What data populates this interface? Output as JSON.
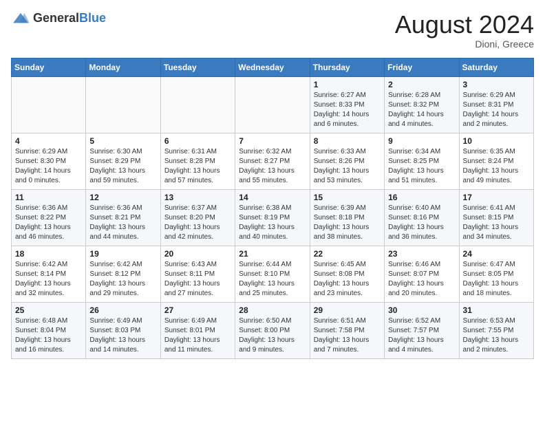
{
  "header": {
    "logo_general": "General",
    "logo_blue": "Blue",
    "month_year": "August 2024",
    "location": "Dioni, Greece"
  },
  "weekdays": [
    "Sunday",
    "Monday",
    "Tuesday",
    "Wednesday",
    "Thursday",
    "Friday",
    "Saturday"
  ],
  "weeks": [
    [
      {
        "day": "",
        "info": ""
      },
      {
        "day": "",
        "info": ""
      },
      {
        "day": "",
        "info": ""
      },
      {
        "day": "",
        "info": ""
      },
      {
        "day": "1",
        "info": "Sunrise: 6:27 AM\nSunset: 8:33 PM\nDaylight: 14 hours\nand 6 minutes."
      },
      {
        "day": "2",
        "info": "Sunrise: 6:28 AM\nSunset: 8:32 PM\nDaylight: 14 hours\nand 4 minutes."
      },
      {
        "day": "3",
        "info": "Sunrise: 6:29 AM\nSunset: 8:31 PM\nDaylight: 14 hours\nand 2 minutes."
      }
    ],
    [
      {
        "day": "4",
        "info": "Sunrise: 6:29 AM\nSunset: 8:30 PM\nDaylight: 14 hours\nand 0 minutes."
      },
      {
        "day": "5",
        "info": "Sunrise: 6:30 AM\nSunset: 8:29 PM\nDaylight: 13 hours\nand 59 minutes."
      },
      {
        "day": "6",
        "info": "Sunrise: 6:31 AM\nSunset: 8:28 PM\nDaylight: 13 hours\nand 57 minutes."
      },
      {
        "day": "7",
        "info": "Sunrise: 6:32 AM\nSunset: 8:27 PM\nDaylight: 13 hours\nand 55 minutes."
      },
      {
        "day": "8",
        "info": "Sunrise: 6:33 AM\nSunset: 8:26 PM\nDaylight: 13 hours\nand 53 minutes."
      },
      {
        "day": "9",
        "info": "Sunrise: 6:34 AM\nSunset: 8:25 PM\nDaylight: 13 hours\nand 51 minutes."
      },
      {
        "day": "10",
        "info": "Sunrise: 6:35 AM\nSunset: 8:24 PM\nDaylight: 13 hours\nand 49 minutes."
      }
    ],
    [
      {
        "day": "11",
        "info": "Sunrise: 6:36 AM\nSunset: 8:22 PM\nDaylight: 13 hours\nand 46 minutes."
      },
      {
        "day": "12",
        "info": "Sunrise: 6:36 AM\nSunset: 8:21 PM\nDaylight: 13 hours\nand 44 minutes."
      },
      {
        "day": "13",
        "info": "Sunrise: 6:37 AM\nSunset: 8:20 PM\nDaylight: 13 hours\nand 42 minutes."
      },
      {
        "day": "14",
        "info": "Sunrise: 6:38 AM\nSunset: 8:19 PM\nDaylight: 13 hours\nand 40 minutes."
      },
      {
        "day": "15",
        "info": "Sunrise: 6:39 AM\nSunset: 8:18 PM\nDaylight: 13 hours\nand 38 minutes."
      },
      {
        "day": "16",
        "info": "Sunrise: 6:40 AM\nSunset: 8:16 PM\nDaylight: 13 hours\nand 36 minutes."
      },
      {
        "day": "17",
        "info": "Sunrise: 6:41 AM\nSunset: 8:15 PM\nDaylight: 13 hours\nand 34 minutes."
      }
    ],
    [
      {
        "day": "18",
        "info": "Sunrise: 6:42 AM\nSunset: 8:14 PM\nDaylight: 13 hours\nand 32 minutes."
      },
      {
        "day": "19",
        "info": "Sunrise: 6:42 AM\nSunset: 8:12 PM\nDaylight: 13 hours\nand 29 minutes."
      },
      {
        "day": "20",
        "info": "Sunrise: 6:43 AM\nSunset: 8:11 PM\nDaylight: 13 hours\nand 27 minutes."
      },
      {
        "day": "21",
        "info": "Sunrise: 6:44 AM\nSunset: 8:10 PM\nDaylight: 13 hours\nand 25 minutes."
      },
      {
        "day": "22",
        "info": "Sunrise: 6:45 AM\nSunset: 8:08 PM\nDaylight: 13 hours\nand 23 minutes."
      },
      {
        "day": "23",
        "info": "Sunrise: 6:46 AM\nSunset: 8:07 PM\nDaylight: 13 hours\nand 20 minutes."
      },
      {
        "day": "24",
        "info": "Sunrise: 6:47 AM\nSunset: 8:05 PM\nDaylight: 13 hours\nand 18 minutes."
      }
    ],
    [
      {
        "day": "25",
        "info": "Sunrise: 6:48 AM\nSunset: 8:04 PM\nDaylight: 13 hours\nand 16 minutes."
      },
      {
        "day": "26",
        "info": "Sunrise: 6:49 AM\nSunset: 8:03 PM\nDaylight: 13 hours\nand 14 minutes."
      },
      {
        "day": "27",
        "info": "Sunrise: 6:49 AM\nSunset: 8:01 PM\nDaylight: 13 hours\nand 11 minutes."
      },
      {
        "day": "28",
        "info": "Sunrise: 6:50 AM\nSunset: 8:00 PM\nDaylight: 13 hours\nand 9 minutes."
      },
      {
        "day": "29",
        "info": "Sunrise: 6:51 AM\nSunset: 7:58 PM\nDaylight: 13 hours\nand 7 minutes."
      },
      {
        "day": "30",
        "info": "Sunrise: 6:52 AM\nSunset: 7:57 PM\nDaylight: 13 hours\nand 4 minutes."
      },
      {
        "day": "31",
        "info": "Sunrise: 6:53 AM\nSunset: 7:55 PM\nDaylight: 13 hours\nand 2 minutes."
      }
    ]
  ]
}
